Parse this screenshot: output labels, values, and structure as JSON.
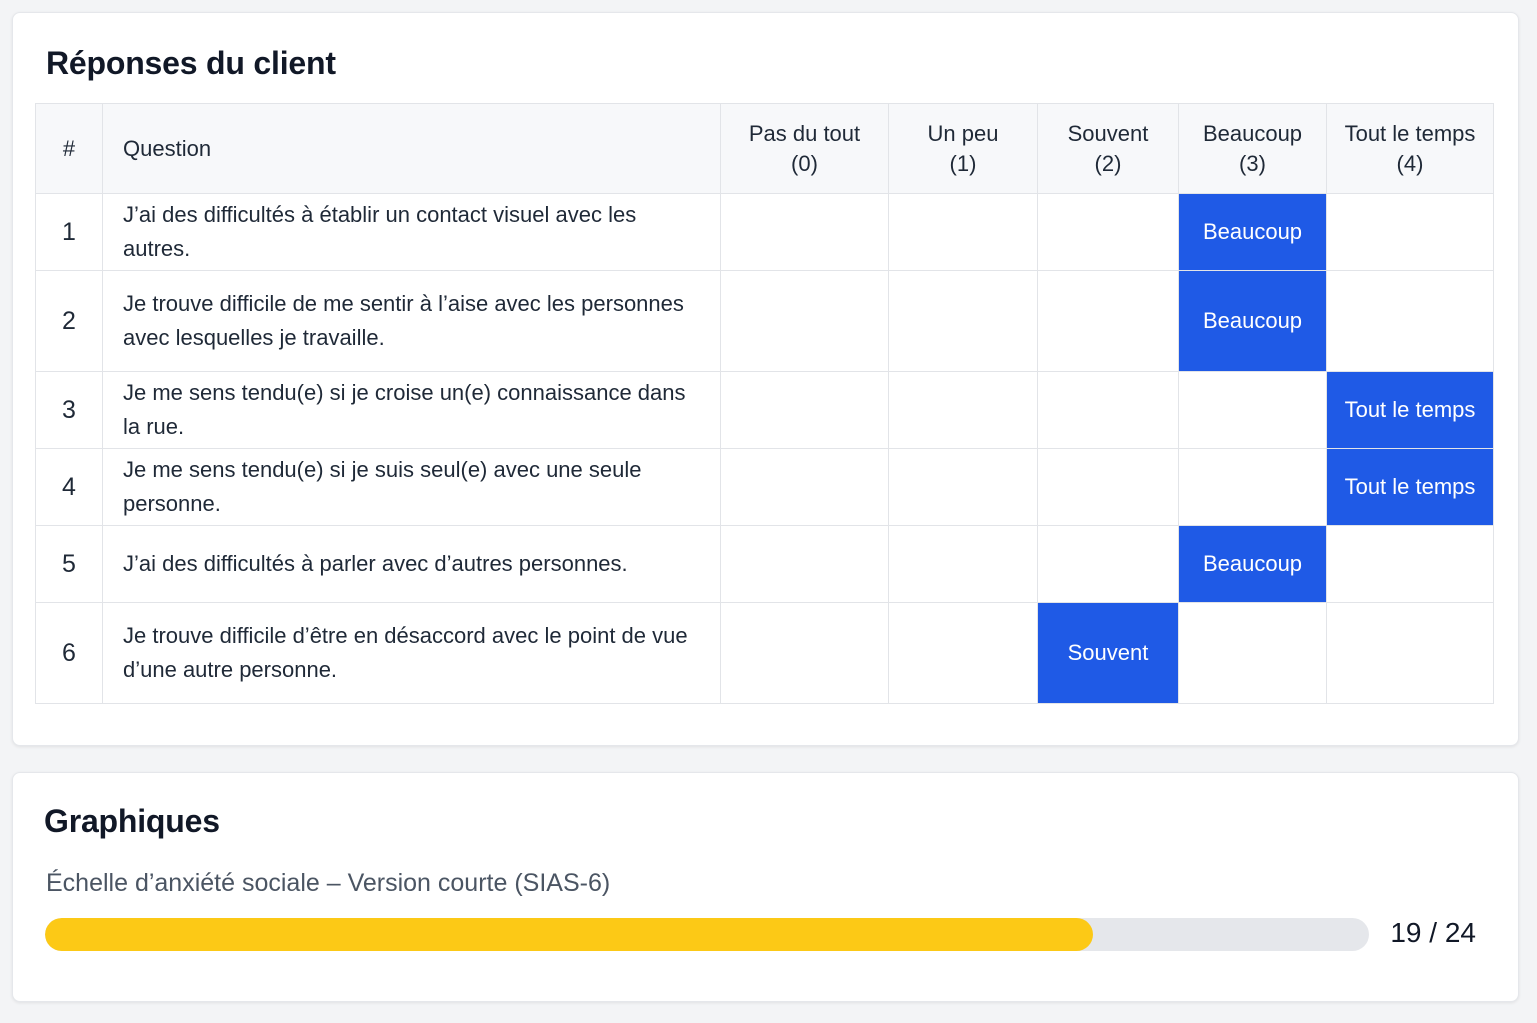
{
  "responses": {
    "title": "Réponses du client",
    "headers": {
      "num": "#",
      "question": "Question",
      "options": [
        {
          "label": "Pas du tout",
          "score": "(0)"
        },
        {
          "label": "Un peu",
          "score": "(1)"
        },
        {
          "label": "Souvent",
          "score": "(2)"
        },
        {
          "label": "Beaucoup",
          "score": "(3)"
        },
        {
          "label": "Tout le temps",
          "score": "(4)"
        }
      ]
    },
    "rows": [
      {
        "num": "1",
        "question": "J’ai des difficultés à établir un contact visuel avec les autres.",
        "selected_index": 3,
        "selected_label": "Beaucoup"
      },
      {
        "num": "2",
        "question": "Je trouve difficile de me sentir à l’aise avec les personnes avec lesquelles je travaille.",
        "selected_index": 3,
        "selected_label": "Beaucoup"
      },
      {
        "num": "3",
        "question": "Je me sens tendu(e) si je croise un(e) connaissance dans la rue.",
        "selected_index": 4,
        "selected_label": "Tout le temps"
      },
      {
        "num": "4",
        "question": "Je me sens tendu(e) si je suis seul(e) avec une seule personne.",
        "selected_index": 4,
        "selected_label": "Tout le temps"
      },
      {
        "num": "5",
        "question": "J’ai des difficultés à parler avec d’autres personnes.",
        "selected_index": 3,
        "selected_label": "Beaucoup"
      },
      {
        "num": "6",
        "question": "Je trouve difficile d’être en désaccord avec le point de vue d’une autre personne.",
        "selected_index": 2,
        "selected_label": "Souvent"
      }
    ]
  },
  "charts": {
    "title": "Graphiques",
    "scale_label": "Échelle d’anxiété sociale – Version courte (SIAS-6)",
    "score_value": 19,
    "score_max": 24,
    "score_text": "19 / 24",
    "bar_color": "#fcc916",
    "track_color": "#e5e7eb"
  },
  "colors": {
    "selected": "#1f5ae6"
  }
}
